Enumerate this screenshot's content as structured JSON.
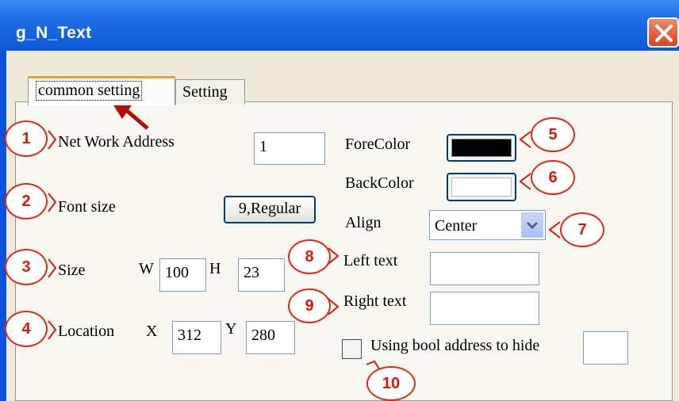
{
  "window": {
    "title": "g_N_Text",
    "close_icon": "close-x-icon"
  },
  "tabs": [
    {
      "label": "common setting",
      "selected": true
    },
    {
      "label": "Setting",
      "selected": false
    }
  ],
  "fields": {
    "net_work_address": {
      "label": "Net Work Address",
      "value": "1"
    },
    "font_size": {
      "label": "Font size",
      "button": "9,Regular"
    },
    "size": {
      "label": "Size",
      "w_label": "W",
      "w_value": "100",
      "h_label": "H",
      "h_value": "23"
    },
    "location": {
      "label": "Location",
      "x_label": "X",
      "x_value": "312",
      "y_label": "Y",
      "y_value": "280"
    },
    "fore_color": {
      "label": "ForeColor",
      "color": "#000000"
    },
    "back_color": {
      "label": "BackColor",
      "color": "#ffffff"
    },
    "align": {
      "label": "Align",
      "selected": "Center"
    },
    "left_text": {
      "label": "Left text",
      "value": ""
    },
    "right_text": {
      "label": "Right text",
      "value": ""
    },
    "bool_hide": {
      "label": "Using bool address to hide",
      "checked": false,
      "value": ""
    }
  },
  "callouts": [
    "1",
    "2",
    "3",
    "4",
    "5",
    "6",
    "7",
    "8",
    "9",
    "10"
  ],
  "colors": {
    "callout": "#e02818",
    "titlebar": "#0d58d6",
    "dialog_bg": "#ece9d8"
  }
}
